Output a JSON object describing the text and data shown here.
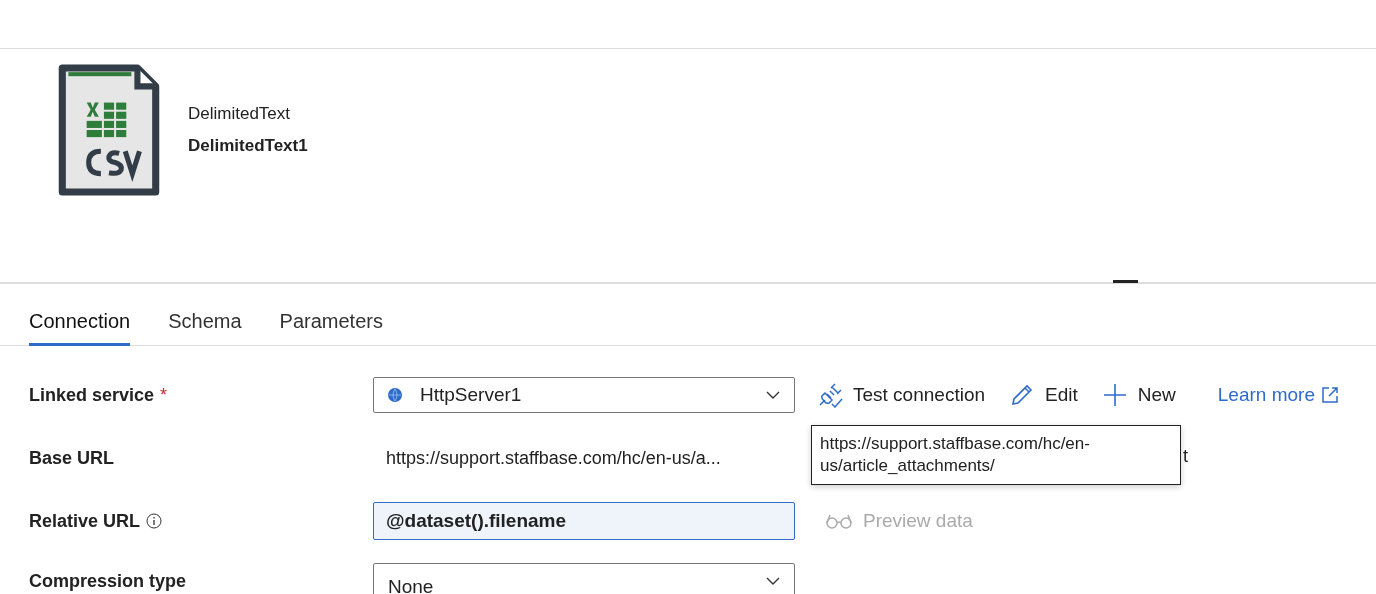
{
  "dataset": {
    "type": "DelimitedText",
    "name": "DelimitedText1"
  },
  "tabs": [
    {
      "label": "Connection",
      "selected": true
    },
    {
      "label": "Schema",
      "selected": false
    },
    {
      "label": "Parameters",
      "selected": false
    }
  ],
  "linked_service": {
    "label": "Linked service",
    "required_mark": "*",
    "value": "HttpServer1",
    "actions": [
      {
        "kind": "test",
        "label": "Test connection"
      },
      {
        "kind": "edit",
        "label": "Edit"
      },
      {
        "kind": "new",
        "label": "New"
      }
    ],
    "link": "Learn more"
  },
  "base_url": {
    "label": "Base URL",
    "value": "https://support.staffbase.com/hc/en-us/a...",
    "hidden_tail": "t",
    "tooltip": "https://support.staffbase.com/hc/en-us/article_attachments/"
  },
  "relative_url": {
    "label": "Relative URL",
    "value": "@dataset().filename",
    "preview": {
      "label": "Preview data",
      "disabled": true
    }
  },
  "compression_type": {
    "label": "Compression type",
    "value": "None"
  }
}
